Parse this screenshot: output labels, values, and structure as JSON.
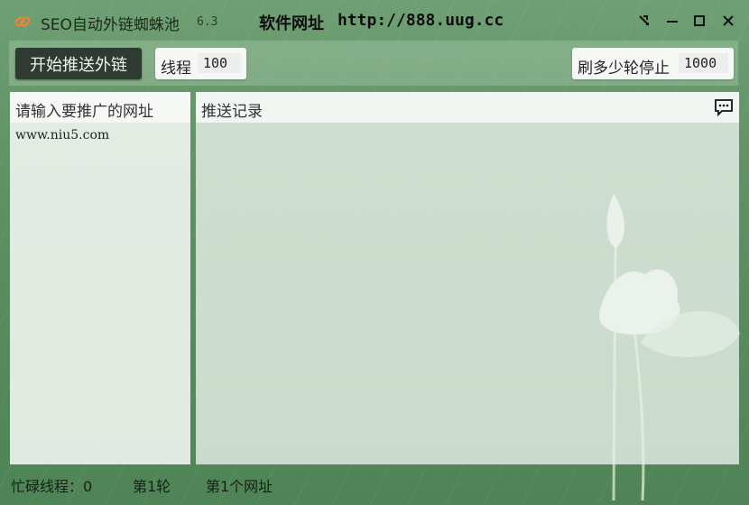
{
  "window": {
    "app_title": "SEO自动外链蜘蛛池",
    "version": "6.3",
    "site_label": "软件网址",
    "site_url": "http://888.uug.cc"
  },
  "toolbar": {
    "start_label": "开始推送外链",
    "threads_label": "线程",
    "threads_value": "100",
    "stop_label": "刷多少轮停止",
    "stop_value": "1000"
  },
  "left_panel": {
    "title": "请输入要推广的网址",
    "url_value": "www.niu5.com"
  },
  "right_panel": {
    "title": "推送记录"
  },
  "status": {
    "busy_threads": "忙碌线程：0",
    "round": "第1轮",
    "url_index": "第1个网址"
  },
  "icons": {
    "app": "link-icon",
    "pin": "pin-icon",
    "minimize": "minimize-icon",
    "maximize": "maximize-icon",
    "close": "close-icon",
    "message": "message-icon"
  },
  "colors": {
    "background": "#5d9063",
    "start_button": "#2f3a33",
    "panel": "#eef3ee"
  }
}
